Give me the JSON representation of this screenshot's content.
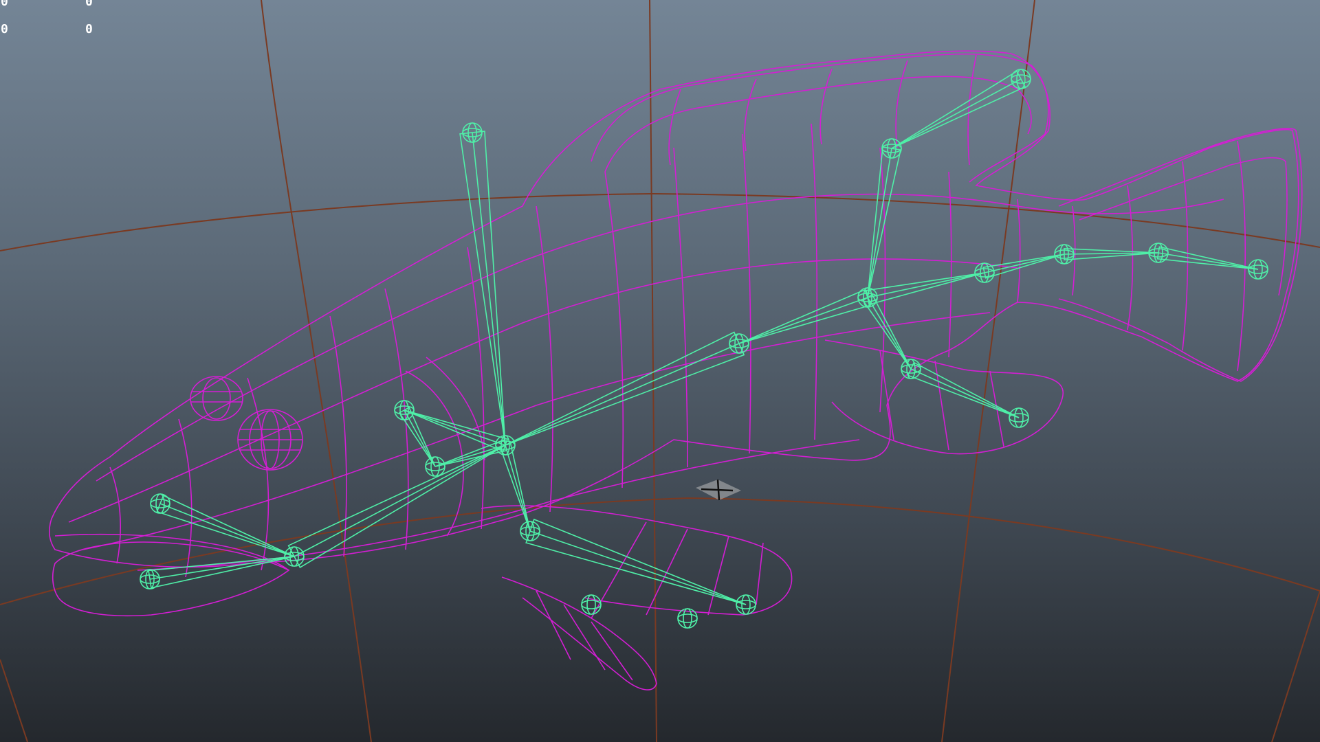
{
  "viewport": {
    "name": "perspective-viewport",
    "background_top": "#748596",
    "background_bottom": "#24282d"
  },
  "hud": {
    "rows": [
      [
        "0",
        "0"
      ],
      [
        "0",
        "0"
      ]
    ]
  },
  "colors": {
    "grid": "#7a3a22",
    "mesh": "#d41ed4",
    "joints": "#4ff0a8",
    "manipulator": "#b8b8b8"
  },
  "scene": {
    "mesh_object": "fish-wireframe-mesh",
    "skeleton": "fish-joint-skeleton",
    "joint_count": 21,
    "icons": [
      "origin-manipulator-icon"
    ]
  }
}
